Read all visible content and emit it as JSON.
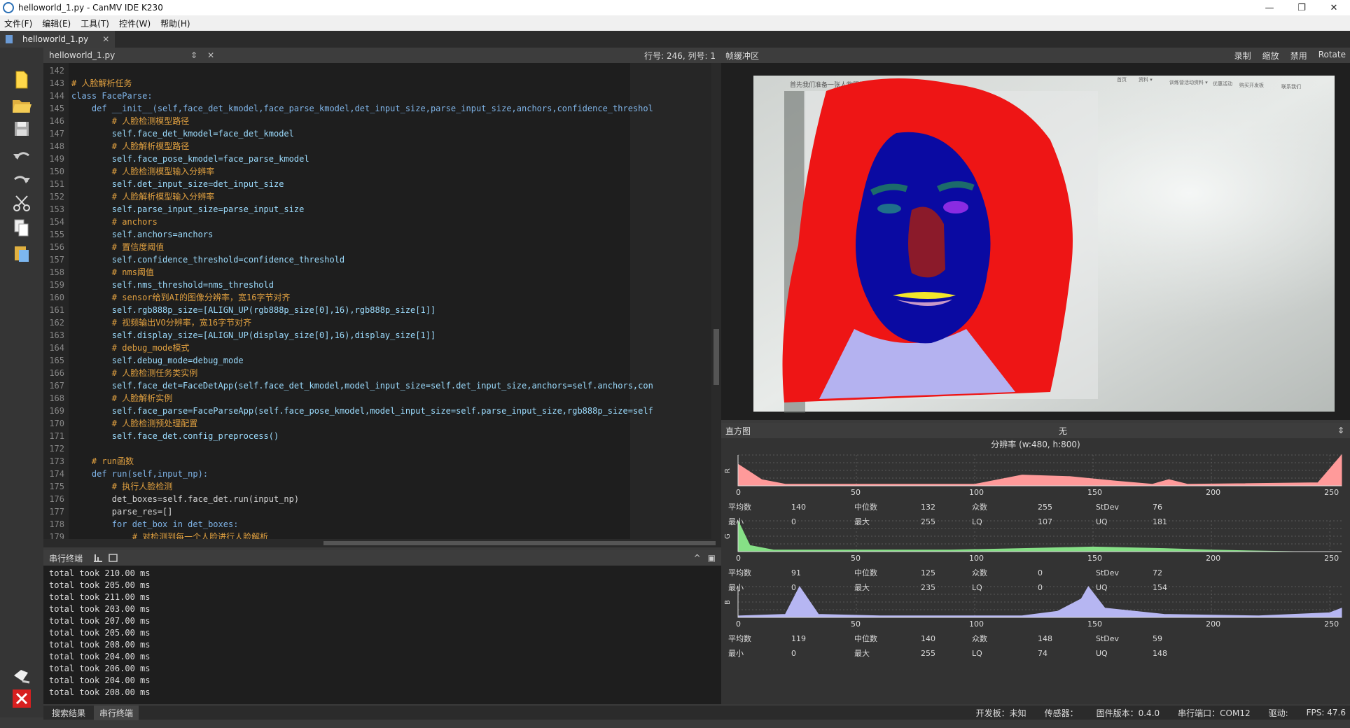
{
  "window": {
    "title": "helloworld_1.py - CanMV IDE K230",
    "minimize": "—",
    "maximize": "❐",
    "close": "✕"
  },
  "menu": [
    "文件(F)",
    "编辑(E)",
    "工具(T)",
    "控件(W)",
    "帮助(H)"
  ],
  "tabs": [
    {
      "label": "helloworld_1.py",
      "close": "✕"
    }
  ],
  "editor": {
    "file": "helloworld_1.py",
    "updown": "⇕",
    "close": "✕",
    "position": "行号: 246, 列号: 1"
  },
  "code_lines": [
    {
      "n": "142",
      "c": ""
    },
    {
      "n": "143",
      "c": "# 人脸解析任务"
    },
    {
      "n": "144",
      "c": "class FaceParse:"
    },
    {
      "n": "145",
      "c": "    def __init__(self,face_det_kmodel,face_parse_kmodel,det_input_size,parse_input_size,anchors,confidence_threshol"
    },
    {
      "n": "146",
      "c": "        # 人脸检测模型路径"
    },
    {
      "n": "147",
      "c": "        self.face_det_kmodel=face_det_kmodel"
    },
    {
      "n": "148",
      "c": "        # 人脸解析模型路径"
    },
    {
      "n": "149",
      "c": "        self.face_pose_kmodel=face_parse_kmodel"
    },
    {
      "n": "150",
      "c": "        # 人脸检测模型输入分辨率"
    },
    {
      "n": "151",
      "c": "        self.det_input_size=det_input_size"
    },
    {
      "n": "152",
      "c": "        # 人脸解析模型输入分辨率"
    },
    {
      "n": "153",
      "c": "        self.parse_input_size=parse_input_size"
    },
    {
      "n": "154",
      "c": "        # anchors"
    },
    {
      "n": "155",
      "c": "        self.anchors=anchors"
    },
    {
      "n": "156",
      "c": "        # 置信度阈值"
    },
    {
      "n": "157",
      "c": "        self.confidence_threshold=confidence_threshold"
    },
    {
      "n": "158",
      "c": "        # nms阈值"
    },
    {
      "n": "159",
      "c": "        self.nms_threshold=nms_threshold"
    },
    {
      "n": "160",
      "c": "        # sensor给到AI的图像分辨率，宽16字节对齐"
    },
    {
      "n": "161",
      "c": "        self.rgb888p_size=[ALIGN_UP(rgb888p_size[0],16),rgb888p_size[1]]"
    },
    {
      "n": "162",
      "c": "        # 视频输出VO分辨率，宽16字节对齐"
    },
    {
      "n": "163",
      "c": "        self.display_size=[ALIGN_UP(display_size[0],16),display_size[1]]"
    },
    {
      "n": "164",
      "c": "        # debug_mode模式"
    },
    {
      "n": "165",
      "c": "        self.debug_mode=debug_mode"
    },
    {
      "n": "166",
      "c": "        # 人脸检测任务类实例"
    },
    {
      "n": "167",
      "c": "        self.face_det=FaceDetApp(self.face_det_kmodel,model_input_size=self.det_input_size,anchors=self.anchors,con"
    },
    {
      "n": "168",
      "c": "        # 人脸解析实例"
    },
    {
      "n": "169",
      "c": "        self.face_parse=FaceParseApp(self.face_pose_kmodel,model_input_size=self.parse_input_size,rgb888p_size=self"
    },
    {
      "n": "170",
      "c": "        # 人脸检测预处理配置"
    },
    {
      "n": "171",
      "c": "        self.face_det.config_preprocess()"
    },
    {
      "n": "172",
      "c": ""
    },
    {
      "n": "173",
      "c": "    # run函数"
    },
    {
      "n": "174",
      "c": "    def run(self,input_np):"
    },
    {
      "n": "175",
      "c": "        # 执行人脸检测"
    },
    {
      "n": "176",
      "c": "        det_boxes=self.face_det.run(input_np)"
    },
    {
      "n": "177",
      "c": "        parse_res=[]"
    },
    {
      "n": "178",
      "c": "        for det_box in det_boxes:"
    },
    {
      "n": "179",
      "c": "            # 对检测到每一个人脸进行人脸解析"
    }
  ],
  "terminal": {
    "label": "串行终端",
    "up": "^",
    "panel": "▣",
    "lines": [
      "total took 210.00 ms",
      "total took 205.00 ms",
      "total took 211.00 ms",
      "total took 203.00 ms",
      "total took 207.00 ms",
      "total took 205.00 ms",
      "total took 208.00 ms",
      "total took 204.00 ms",
      "total took 206.00 ms",
      "total took 204.00 ms",
      "total took 208.00 ms"
    ]
  },
  "bottom_tabs": [
    "搜索结果",
    "串行终端"
  ],
  "framebuffer": {
    "label": "帧缓冲区",
    "actions": [
      "录制",
      "缩放",
      "禁用",
      "Rotate"
    ],
    "screen_texts": [
      "首先我们准备一张人物照片",
      "首页",
      "资料 ▾",
      "训练营活动资料 ▾",
      "优惠活动",
      "购买开发板",
      "联系我们"
    ]
  },
  "histogram": {
    "label": "直方图",
    "mode": "无",
    "arrow": "⇕",
    "resolution": "分辨率 (w:480, h:800)",
    "ticks": [
      "0",
      "50",
      "100",
      "150",
      "200",
      "250"
    ],
    "stat_labels": [
      "平均数",
      "中位数",
      "众数",
      "StDev",
      "最小",
      "最大",
      "LQ",
      "UQ"
    ],
    "channels": [
      {
        "name": "R",
        "color": "#ff9a9a",
        "stats": {
          "mean": "140",
          "median": "132",
          "mode": "255",
          "stdev": "76",
          "min": "0",
          "max": "255",
          "lq": "107",
          "uq": "181"
        },
        "profile": [
          [
            0,
            0.7
          ],
          [
            10,
            0.2
          ],
          [
            20,
            0.05
          ],
          [
            100,
            0.05
          ],
          [
            110,
            0.2
          ],
          [
            120,
            0.35
          ],
          [
            140,
            0.3
          ],
          [
            160,
            0.15
          ],
          [
            175,
            0.05
          ],
          [
            182,
            0.2
          ],
          [
            190,
            0.05
          ],
          [
            245,
            0.1
          ],
          [
            255,
            1.0
          ]
        ]
      },
      {
        "name": "G",
        "color": "#86e086",
        "stats": {
          "mean": "91",
          "median": "125",
          "mode": "0",
          "stdev": "72",
          "min": "0",
          "max": "235",
          "lq": "0",
          "uq": "154"
        },
        "profile": [
          [
            0,
            1.0
          ],
          [
            5,
            0.2
          ],
          [
            15,
            0.05
          ],
          [
            90,
            0.05
          ],
          [
            120,
            0.1
          ],
          [
            150,
            0.15
          ],
          [
            180,
            0.1
          ],
          [
            200,
            0.05
          ],
          [
            235,
            0.0
          ],
          [
            255,
            0.0
          ]
        ]
      },
      {
        "name": "B",
        "color": "#b6b6f2",
        "stats": {
          "mean": "119",
          "median": "140",
          "mode": "148",
          "stdev": "59",
          "min": "0",
          "max": "255",
          "lq": "74",
          "uq": "148"
        },
        "profile": [
          [
            0,
            0.05
          ],
          [
            20,
            0.1
          ],
          [
            26,
            1.0
          ],
          [
            34,
            0.1
          ],
          [
            60,
            0.05
          ],
          [
            120,
            0.05
          ],
          [
            135,
            0.2
          ],
          [
            145,
            0.6
          ],
          [
            148,
            1.0
          ],
          [
            155,
            0.3
          ],
          [
            180,
            0.1
          ],
          [
            220,
            0.05
          ],
          [
            250,
            0.15
          ],
          [
            255,
            0.3
          ]
        ]
      }
    ]
  },
  "status": [
    "开发板：未知",
    "传感器：",
    "固件版本：0.4.0",
    "串行端口：COM12",
    "驱动:",
    "FPS: 47.6"
  ]
}
